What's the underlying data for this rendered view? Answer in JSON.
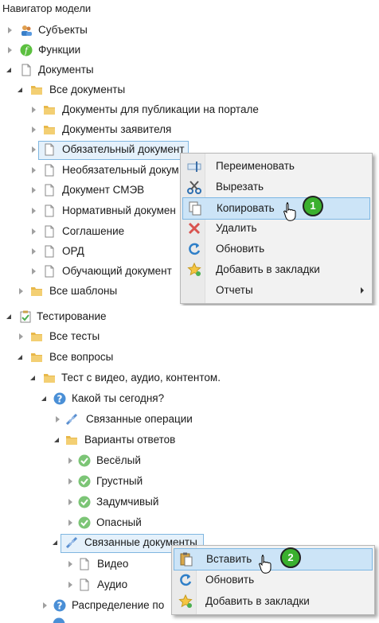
{
  "panel": {
    "title": "Навигатор модели"
  },
  "tree_top": [
    {
      "label": "Субъекты"
    },
    {
      "label": "Функции"
    },
    {
      "label": "Документы"
    },
    {
      "label": "Все документы"
    },
    {
      "label": "Документы для публикации на портале"
    },
    {
      "label": "Документы заявителя"
    },
    {
      "label": "Обязательный документ"
    },
    {
      "label": "Необязательный докум"
    },
    {
      "label": "Документ СМЭВ"
    },
    {
      "label": "Нормативный докумен"
    },
    {
      "label": "Соглашение"
    },
    {
      "label": "ОРД"
    },
    {
      "label": "Обучающий документ"
    },
    {
      "label": "Все шаблоны"
    }
  ],
  "tree_bottom": [
    {
      "label": "Тестирование"
    },
    {
      "label": "Все тесты"
    },
    {
      "label": "Все вопросы"
    },
    {
      "label": "Тест с видео, аудио, контентом."
    },
    {
      "label": "Какой ты сегодня?"
    },
    {
      "label": "Связанные операции"
    },
    {
      "label": "Варианты ответов"
    },
    {
      "label": "Весёлый"
    },
    {
      "label": "Грустный"
    },
    {
      "label": "Задумчивый"
    },
    {
      "label": "Опасный"
    },
    {
      "label": "Связанные документы"
    },
    {
      "label": "Видео"
    },
    {
      "label": "Аудио"
    },
    {
      "label": "Распределение по"
    }
  ],
  "menu1": {
    "items": [
      {
        "label": "Переименовать",
        "icon": "rename-icon"
      },
      {
        "label": "Вырезать",
        "icon": "scissors-icon"
      },
      {
        "label": "Копировать",
        "icon": "copy-icon"
      },
      {
        "label": "Удалить",
        "icon": "delete-icon"
      },
      {
        "label": "Обновить",
        "icon": "refresh-icon"
      },
      {
        "label": "Добавить в закладки",
        "icon": "bookmark-star-icon"
      },
      {
        "label": "Отчеты",
        "icon": "submenu-arrow-icon"
      }
    ],
    "highlighted": "Копировать",
    "step": "1"
  },
  "menu2": {
    "items": [
      {
        "label": "Вставить",
        "icon": "paste-icon"
      },
      {
        "label": "Обновить",
        "icon": "refresh-icon"
      },
      {
        "label": "Добавить в закладки",
        "icon": "bookmark-star-icon"
      }
    ],
    "highlighted": "Вставить",
    "step": "2"
  },
  "colors": {
    "selection": "#e5f1fb",
    "selection_border": "#7fb6e0",
    "menu_highlight": "#cce4f7",
    "badge": "#3ab02e",
    "folder": "#e8b84a",
    "question": "#4a8fd6",
    "answer": "#7cc576"
  }
}
